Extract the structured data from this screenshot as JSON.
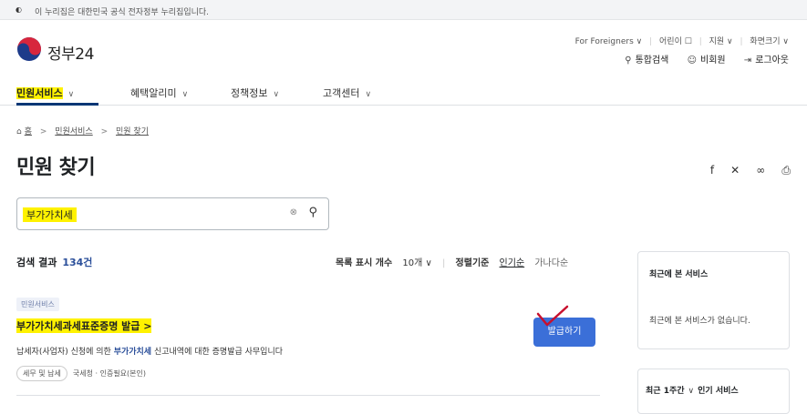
{
  "banner": {
    "text": "이 누리집은 대한민국 공식 전자정부 누리집입니다."
  },
  "logo": {
    "name": "정부24"
  },
  "utility": {
    "foreigners": "For Foreigners ∨",
    "kids": "어린이 ☐",
    "support": "지원 ∨",
    "screen_size": "화면크기 ∨"
  },
  "user_links": {
    "search": "통합검색",
    "member": "비회원",
    "logout": "로그아웃"
  },
  "gnb": [
    {
      "label": "민원서비스"
    },
    {
      "label": "혜택알리미"
    },
    {
      "label": "정책정보"
    },
    {
      "label": "고객센터"
    }
  ],
  "breadcrumb": {
    "home": "홈",
    "level1": "민원서비스",
    "level2": "민원 찾기"
  },
  "page_title": "민원 찾기",
  "search": {
    "value": "부가가치세"
  },
  "results": {
    "label": "검색 결과",
    "count": "134건"
  },
  "sort": {
    "per_page_label": "목록 표시 개수",
    "per_page_value": "10개 ∨",
    "order_label": "정렬기준",
    "popular": "인기순",
    "alpha": "가나다순"
  },
  "card": {
    "badge": "민원서비스",
    "title": "부가가치세과세표준증명 발급 >",
    "desc_pre": "납세자(사업자) 신청에 의한 ",
    "desc_kw": "부가가치세",
    "desc_post": " 신고내역에 대한 증명발급 사무입니다",
    "tags": [
      "세무 및 납세",
      "국세청 · 인증필요(본인)"
    ],
    "button": "발급하기"
  },
  "side": {
    "recent_title": "최근에 본 서비스",
    "recent_empty": "최근에 본 서비스가 없습니다.",
    "popular_period": "최근 1주간",
    "popular_title": "인기 서비스"
  }
}
